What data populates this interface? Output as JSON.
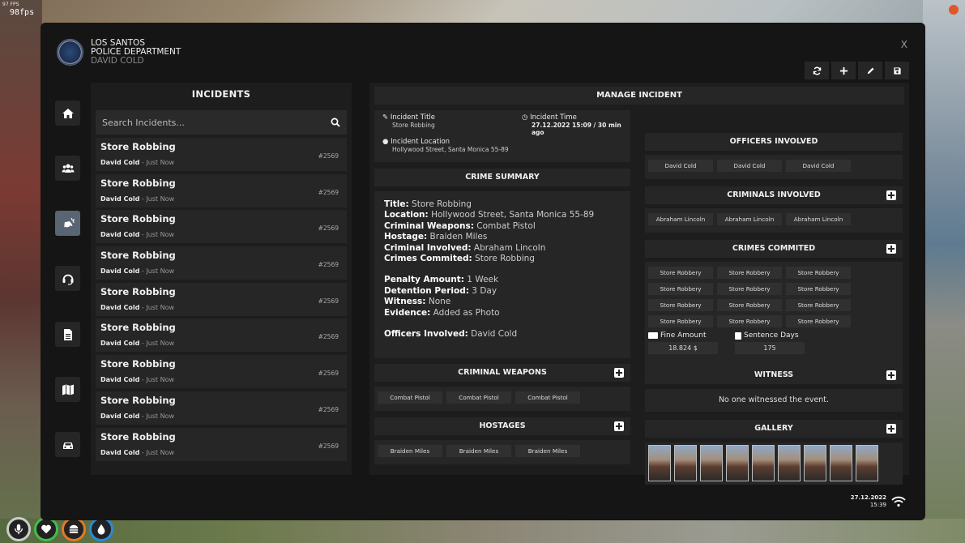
{
  "overlay": {
    "fps_small": "97 FPS",
    "fps_large": "98fps",
    "top_right_label": "",
    "bottom_right_label": ""
  },
  "header": {
    "dept_line1": "LOS SANTOS",
    "dept_line2": "POLICE DEPARTMENT",
    "user": "DAVID COLD",
    "close": "X"
  },
  "toolbar": [
    "refresh-icon",
    "plus-icon",
    "pencil-icon",
    "save-icon"
  ],
  "sidebar": [
    "home-icon",
    "users-icon",
    "car-crash-icon",
    "headset-icon",
    "document-icon",
    "map-icon",
    "car-icon"
  ],
  "incidents": {
    "title": "INCIDENTS",
    "search_placeholder": "Search Incidents...",
    "items": [
      {
        "title": "Store Robbing",
        "officer": "David Cold",
        "time": "Just Now",
        "id": "#2569"
      },
      {
        "title": "Store Robbing",
        "officer": "David Cold",
        "time": "Just Now",
        "id": "#2569"
      },
      {
        "title": "Store Robbing",
        "officer": "David Cold",
        "time": "Just Now",
        "id": "#2569"
      },
      {
        "title": "Store Robbing",
        "officer": "David Cold",
        "time": "Just Now",
        "id": "#2569"
      },
      {
        "title": "Store Robbing",
        "officer": "David Cold",
        "time": "Just Now",
        "id": "#2569"
      },
      {
        "title": "Store Robbing",
        "officer": "David Cold",
        "time": "Just Now",
        "id": "#2569"
      },
      {
        "title": "Store Robbing",
        "officer": "David Cold",
        "time": "Just Now",
        "id": "#2569"
      },
      {
        "title": "Store Robbing",
        "officer": "David Cold",
        "time": "Just Now",
        "id": "#2569"
      },
      {
        "title": "Store Robbing",
        "officer": "David Cold",
        "time": "Just Now",
        "id": "#2569"
      }
    ]
  },
  "manage": {
    "title": "MANAGE INCIDENT",
    "incident_title_label": "Incident Title",
    "incident_title_value": "Store Robbing",
    "incident_time_label": "Incident Time",
    "incident_time_date": "27.12.2022 15:09",
    "incident_time_ago": "30 min ago",
    "incident_location_label": "Incident Location",
    "incident_location_value": "Hollywood Street, Santa Monica 55-89",
    "crime_summary_title": "CRIME SUMMARY",
    "summary": {
      "title_k": "Title:",
      "title_v": "Store Robbing",
      "location_k": "Location:",
      "location_v": "Hollywood Street, Santa Monica 55-89",
      "weapons_k": "Criminal Weapons:",
      "weapons_v": "Combat Pistol",
      "hostage_k": "Hostage:",
      "hostage_v": "Braiden Miles",
      "criminal_k": "Criminal Involved:",
      "criminal_v": "Abraham Lincoln",
      "crimes_k": "Crimes Commited:",
      "crimes_v": "Store Robbing",
      "penalty_k": "Penalty Amount:",
      "penalty_v": "1 Week",
      "detention_k": "Detention Period:",
      "detention_v": "3 Day",
      "witness_k": "Witness:",
      "witness_v": "None",
      "evidence_k": "Evidence:",
      "evidence_v": "Added as Photo",
      "officers_k": "Officers Involved:",
      "officers_v": "David Cold"
    },
    "weapons_title": "CRIMINAL WEAPONS",
    "weapons": [
      "Combat Pistol",
      "Combat Pistol",
      "Combat Pistol"
    ],
    "hostages_title": "HOSTAGES",
    "hostages": [
      "Braiden Miles",
      "Braiden Miles",
      "Braiden Miles"
    ],
    "officers_title": "OFFICERS INVOLVED",
    "officers": [
      "David Cold",
      "David Cold",
      "David Cold"
    ],
    "criminals_title": "CRIMINALS INVOLVED",
    "criminals": [
      "Abraham Lincoln",
      "Abraham Lincoln",
      "Abraham Lincoln"
    ],
    "crimes_title": "CRIMES COMMITED",
    "crimes": [
      "Store Robbery",
      "Store Robbery",
      "Store Robbery",
      "Store Robbery",
      "Store Robbery",
      "Store Robbery",
      "Store Robbery",
      "Store Robbery",
      "Store Robbery",
      "Store Robbery",
      "Store Robbery",
      "Store Robbery"
    ],
    "fine_label": "Fine Amount",
    "fine_value": "18.824 $",
    "sentence_label": "Sentence Days",
    "sentence_value": "175",
    "witness_title": "WITNESS",
    "witness_text": "No one witnessed the event.",
    "gallery_title": "GALLERY",
    "gallery_count": 9
  },
  "footer": {
    "date": "27.12.2022",
    "time": "15:39"
  },
  "colors": {
    "tablet_bg": "#151515",
    "panel_bg": "#1d1d1d",
    "card_bg": "#262626",
    "active_nav": "#5a6573",
    "hud_mic": "#cccccc",
    "hud_health": "#3fbf4a",
    "hud_food": "#e07a2a",
    "hud_water": "#2a8ad6"
  }
}
